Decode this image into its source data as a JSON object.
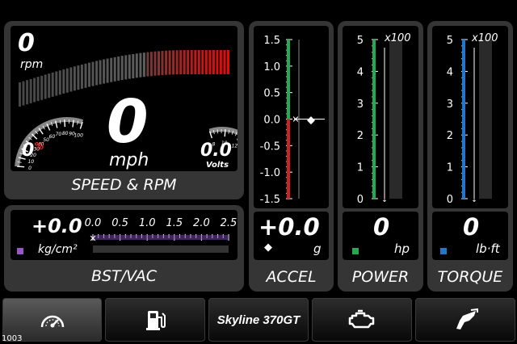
{
  "speed_panel": {
    "title": "SPEED & RPM",
    "rpm_value": "0",
    "rpm_unit": "rpm",
    "speed_value": "0",
    "speed_unit": "mph",
    "throttle_value": "0",
    "throttle_unit": "%",
    "throttle_ticks": [
      "0",
      "10",
      "20",
      "30",
      "40",
      "50",
      "60",
      "70",
      "80",
      "90",
      "100"
    ],
    "volts_value": "0.0",
    "volts_unit": "Volts",
    "volts_ticks": [
      "8",
      "10",
      "12",
      "14",
      "16"
    ]
  },
  "boost_panel": {
    "title": "BST/VAC",
    "value": "+0.0",
    "unit": "kg/cm²",
    "ticks": [
      "0.0",
      "0.5",
      "1.0",
      "1.5",
      "2.0",
      "2.5"
    ],
    "marker_color": "#9955cc"
  },
  "accel_panel": {
    "title": "ACCEL",
    "value": "+0.0",
    "unit": "g",
    "ticks": [
      "1.5",
      "1.0",
      "0.5",
      "0.0",
      "-0.5",
      "-1.0",
      "-1.5"
    ]
  },
  "power_panel": {
    "title": "POWER",
    "value": "0",
    "unit": "hp",
    "multiplier": "x100",
    "ticks": [
      "5",
      "4",
      "3",
      "2",
      "1",
      "0"
    ],
    "marker_color": "#22aa55"
  },
  "torque_panel": {
    "title": "TORQUE",
    "value": "0",
    "unit": "lb·ft",
    "multiplier": "x100",
    "ticks": [
      "5",
      "4",
      "3",
      "2",
      "1",
      "0"
    ],
    "marker_color": "#2277cc"
  },
  "tabs": {
    "gauge_icon": "speedometer-icon",
    "fuel_icon": "fuel-pump-icon",
    "car_name": "Skyline 370GT",
    "engine_icon": "engine-icon",
    "nozzle_icon": "fuel-nozzle-icon"
  },
  "status_code": "1003"
}
